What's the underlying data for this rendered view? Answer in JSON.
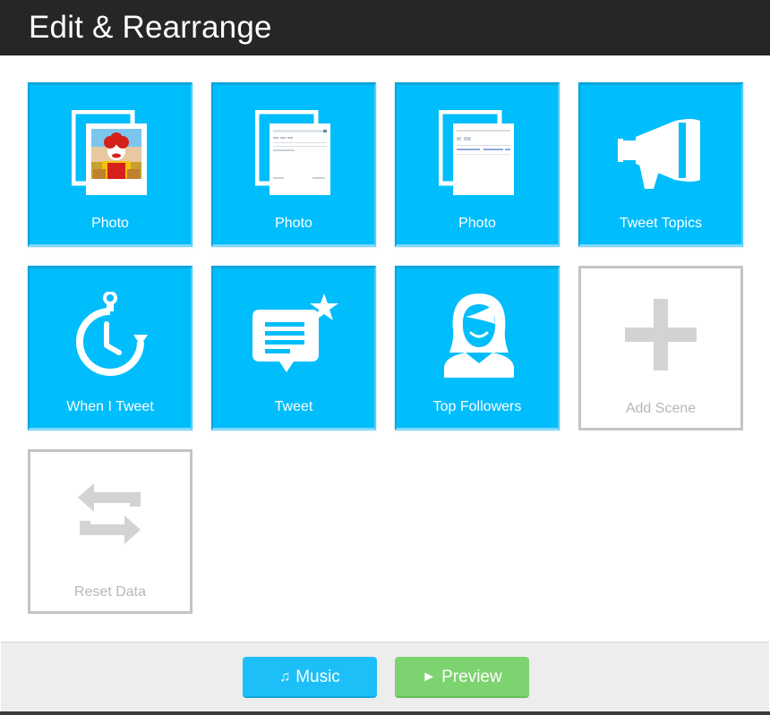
{
  "header": {
    "title": "Edit & Rearrange"
  },
  "tiles": [
    {
      "label": "Photo",
      "icon": "photo-stack-icon"
    },
    {
      "label": "Photo",
      "icon": "photo-stack-icon"
    },
    {
      "label": "Photo",
      "icon": "photo-stack-icon"
    },
    {
      "label": "Tweet Topics",
      "icon": "megaphone-icon"
    },
    {
      "label": "When I Tweet",
      "icon": "stopwatch-icon"
    },
    {
      "label": "Tweet",
      "icon": "speech-bubble-star-icon"
    },
    {
      "label": "Top Followers",
      "icon": "person-icon"
    },
    {
      "label": "Add Scene",
      "icon": "plus-icon"
    },
    {
      "label": "Reset Data",
      "icon": "repeat-arrows-icon"
    }
  ],
  "footer": {
    "music_label": "Music",
    "music_icon": "music-note-icon",
    "preview_label": "Preview",
    "preview_icon": "play-icon"
  },
  "colors": {
    "header_bg": "#262626",
    "tile_blue": "#00bdfc",
    "tile_gray_border": "#c4c4c4",
    "music_button": "#1cbff7",
    "preview_button": "#7dd36f"
  }
}
